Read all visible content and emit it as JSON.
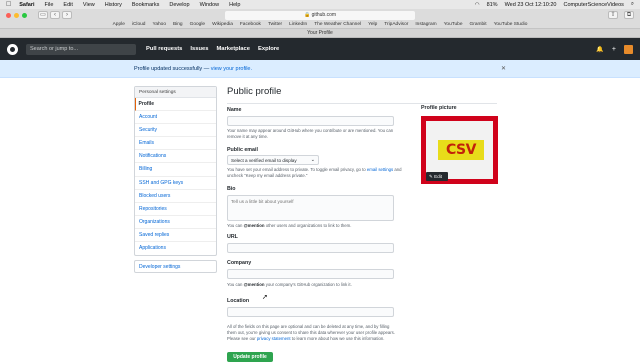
{
  "menubar": {
    "apple": "",
    "items": [
      "Safari",
      "File",
      "Edit",
      "View",
      "History",
      "Bookmarks",
      "Develop",
      "Window",
      "Help"
    ],
    "battery": "81%",
    "datetime": "Wed 23 Oct 12:10:20",
    "user": "ComputerScienceVideos"
  },
  "safari": {
    "url": "github.com",
    "favorites": [
      "Apple",
      "iCloud",
      "Yahoo",
      "Bing",
      "Google",
      "Wikipedia",
      "Facebook",
      "Twitter",
      "LinkedIn",
      "The Weather Channel",
      "Yelp",
      "TripAdvisor",
      "Instagram",
      "YouTube",
      "Grambit",
      "YouTube Studio"
    ],
    "tab_title": "Your Profile"
  },
  "github": {
    "search_placeholder": "Search or jump to...",
    "nav": [
      "Pull requests",
      "Issues",
      "Marketplace",
      "Explore"
    ],
    "plus": "+",
    "bell": "🔔"
  },
  "flash": {
    "message": "Profile updated successfully —",
    "link": "view your profile.",
    "close": "✕"
  },
  "sidebar": {
    "heading": "Personal settings",
    "items": [
      "Profile",
      "Account",
      "Security",
      "Emails",
      "Notifications",
      "Billing",
      "SSH and GPG keys",
      "Blocked users",
      "Repositories",
      "Organizations",
      "Saved replies",
      "Applications"
    ],
    "developer": "Developer settings"
  },
  "profile": {
    "title": "Public profile",
    "name_label": "Name",
    "name_value": "",
    "name_note": "Your name may appear around GitHub where you contribute or are mentioned. You can remove it at any time.",
    "email_label": "Public email",
    "email_select": "Select a verified email to display",
    "email_note_1": "You have set your email address to private. To toggle email privacy, go to",
    "email_note_link": "email settings",
    "email_note_2": "and uncheck \"Keep my email address private.\"",
    "bio_label": "Bio",
    "bio_placeholder": "Tell us a little bit about yourself",
    "bio_note_1": "You can",
    "bio_note_mention": "@mention",
    "bio_note_2": "other users and organizations to link to them.",
    "url_label": "URL",
    "company_label": "Company",
    "company_note_1": "You can",
    "company_note_mention": "@mention",
    "company_note_2": "your company's GitHub organization to link it.",
    "location_label": "Location",
    "footer_note_1": "All of the fields on this page are optional and can be deleted at any time, and by filling them out, you're giving us consent to share this data wherever your user profile appears. Please see our",
    "footer_note_link": "privacy statement",
    "footer_note_2": "to learn more about how we use this information.",
    "update_button": "Update profile",
    "picture_label": "Profile picture",
    "picture_text": "CSV",
    "edit_label": "✎ Edit"
  },
  "colors": {
    "header": "#24292e",
    "flash_bg": "#dbedff",
    "avatar_frame": "#d0021b",
    "avatar_badge": "#e8dc1a",
    "button": "#2ea44f"
  }
}
